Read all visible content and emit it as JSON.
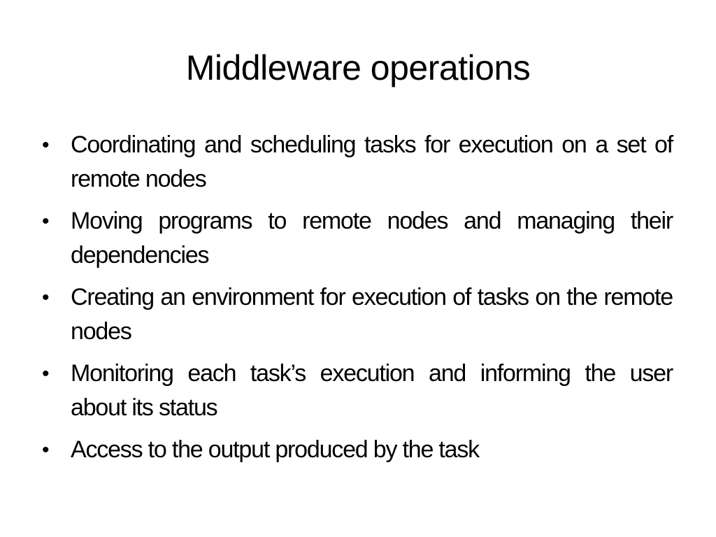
{
  "slide": {
    "title": "Middleware operations",
    "bullet_glyph": "•",
    "bullets": [
      {
        "text": "Coordinating and scheduling tasks for execution on a set of remote nodes"
      },
      {
        "text": "Moving programs to remote nodes and managing their dependencies"
      },
      {
        "text": "Creating an environment for execution of tasks on the remote nodes"
      },
      {
        "text": "Monitoring each task’s execution and informing the user about its status"
      },
      {
        "text": "Access to the output produced by the task"
      }
    ]
  }
}
